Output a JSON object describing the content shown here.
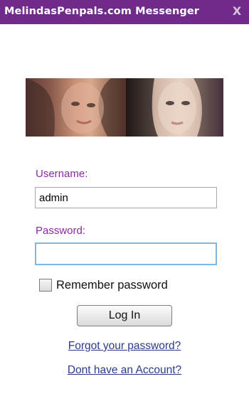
{
  "window": {
    "title": "MelindasPenpals.com Messenger",
    "close_label": "X"
  },
  "login": {
    "username_label": "Username:",
    "username_value": "admin",
    "password_label": "Password:",
    "password_value": "",
    "remember_label": "Remember password",
    "remember_checked": false,
    "login_button": "Log In",
    "forgot_link": "Forgot your password?",
    "signup_link": "Dont have an Account?"
  },
  "colors": {
    "titlebar": "#6f2a8a",
    "label": "#8a2aa0",
    "link": "#2a3b8f",
    "focus_border": "#7fb7e3"
  }
}
